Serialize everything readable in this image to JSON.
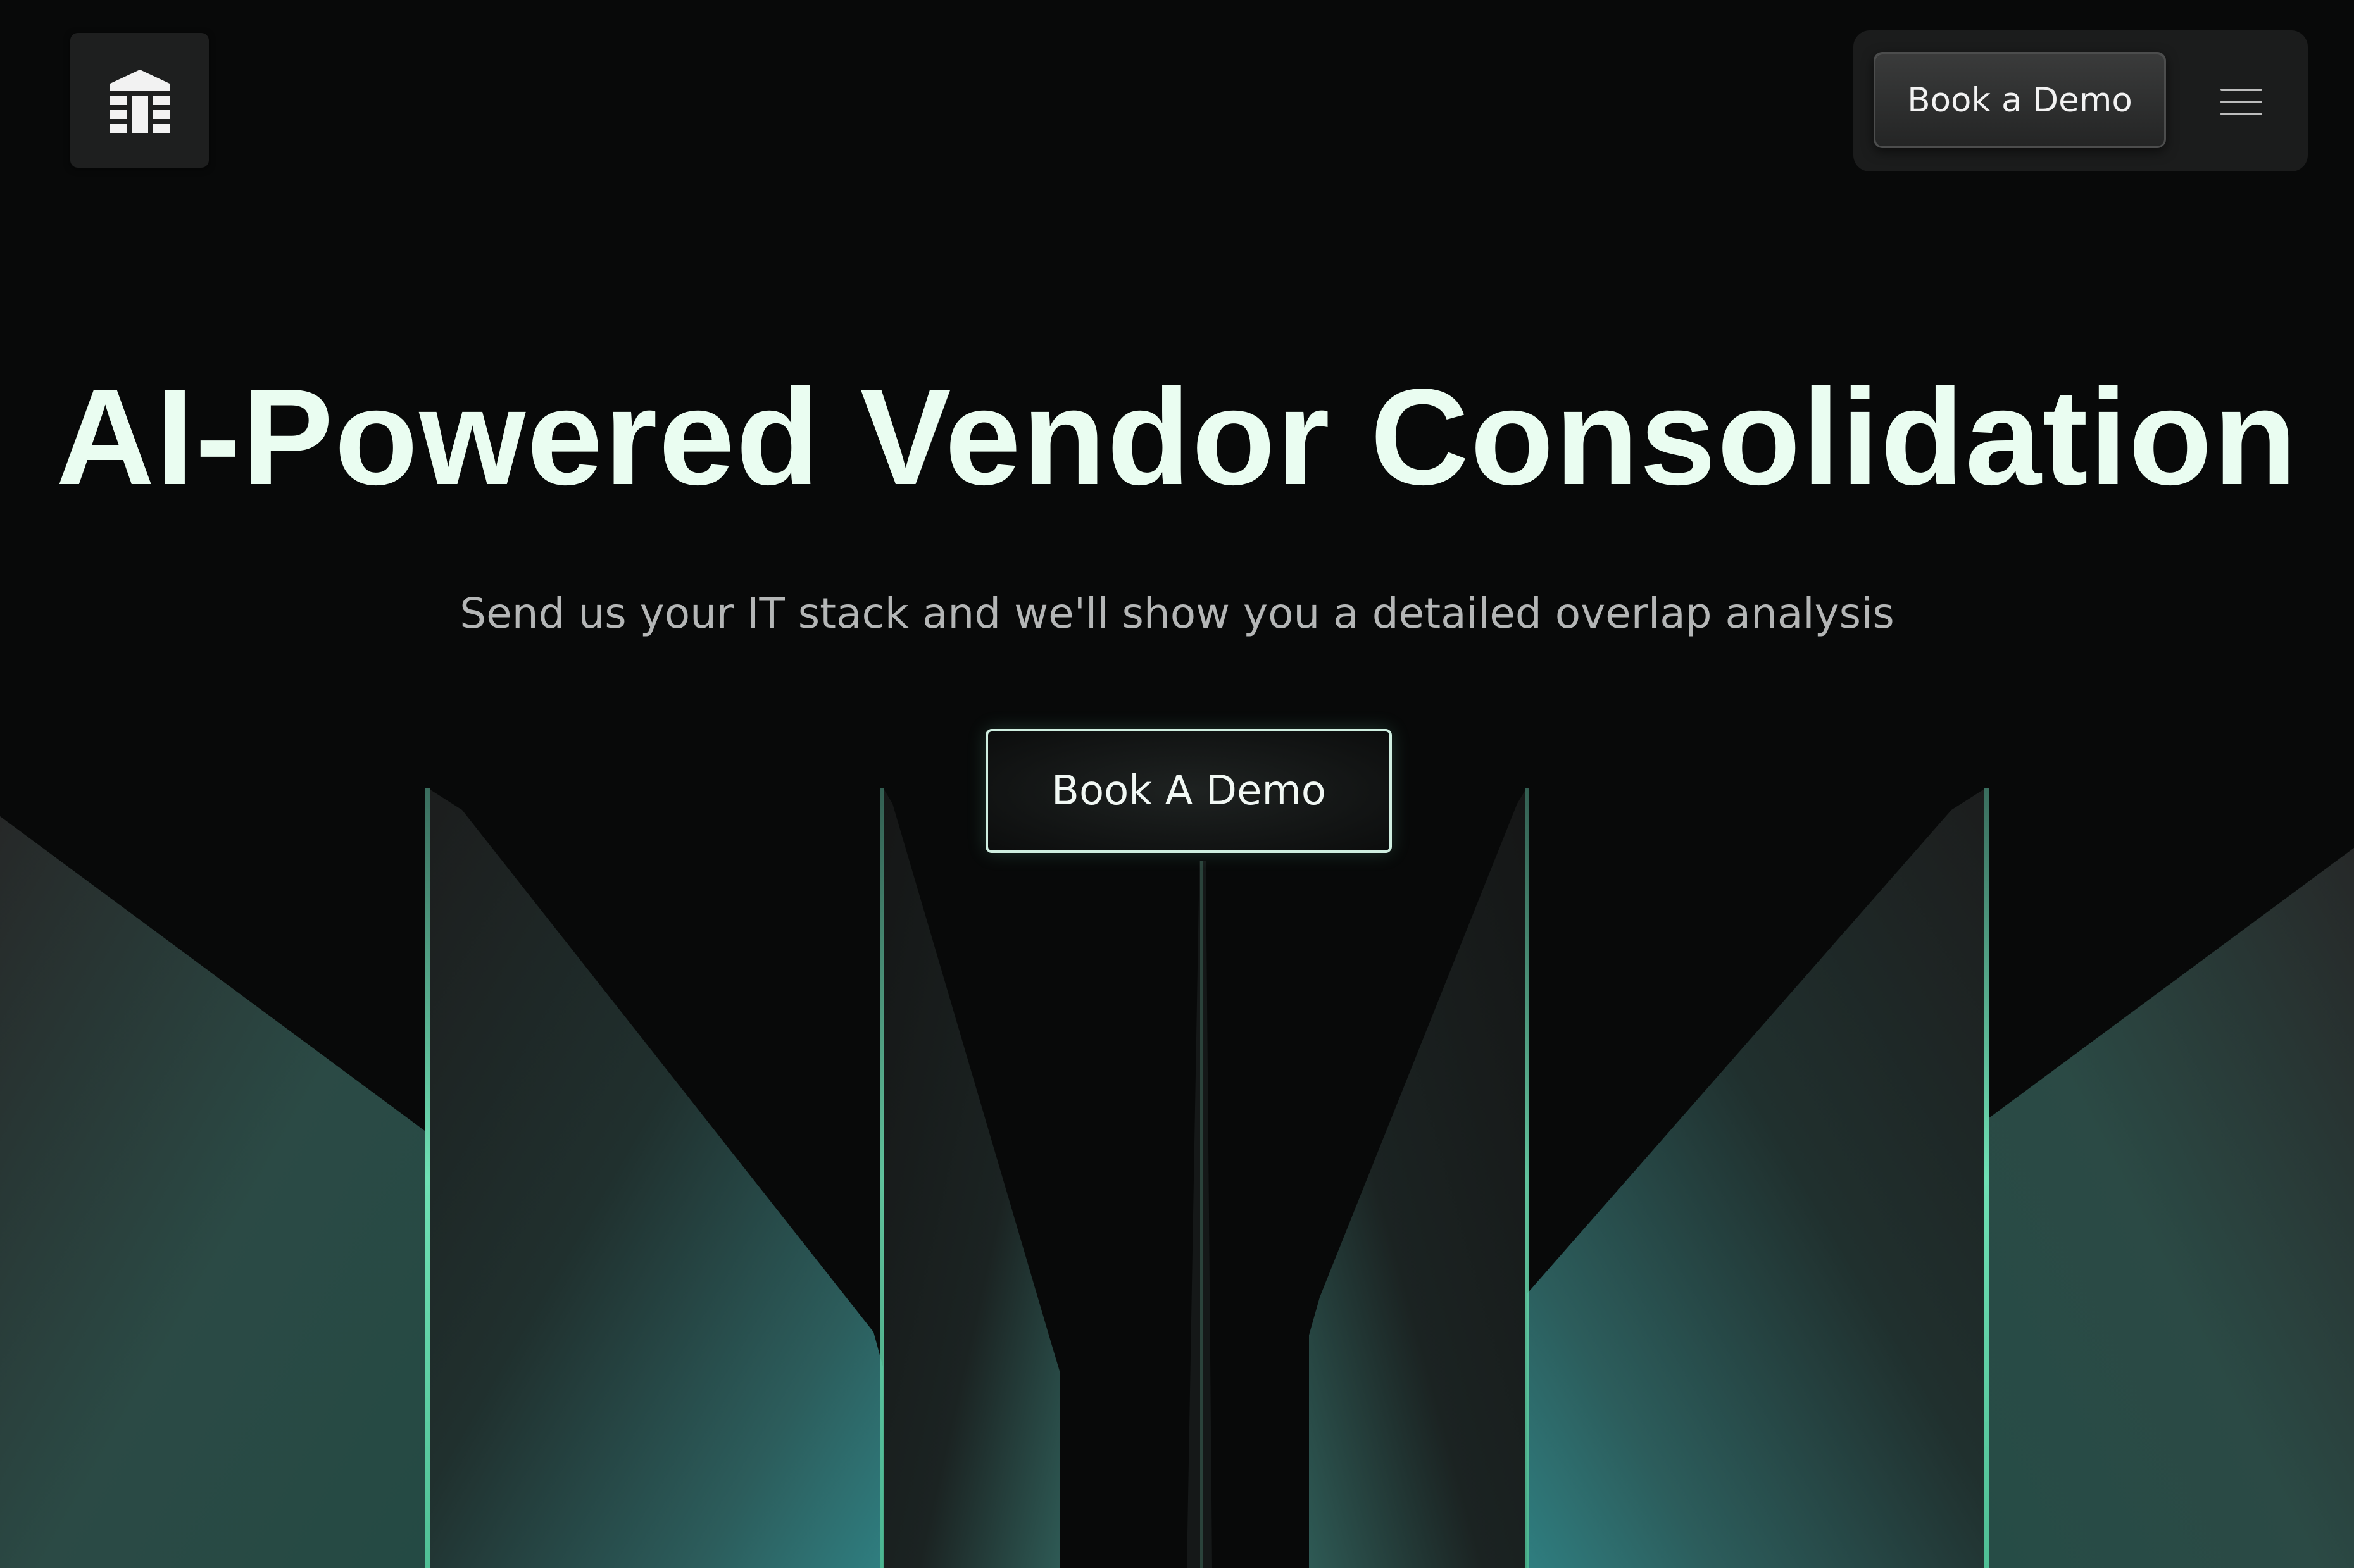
{
  "header": {
    "logo_icon": "building-logo-icon",
    "nav_demo_label": "Book a Demo",
    "menu_icon": "hamburger-menu-icon"
  },
  "hero": {
    "title": "AI-Powered Vendor Consolidation",
    "subtitle": "Send us your IT stack and we'll show you a detailed overlap analysis",
    "cta_label": "Book A Demo"
  },
  "colors": {
    "background": "#080909",
    "title": "#eafdf1",
    "subtitle": "#b4b6b6",
    "accent_edge": "#6ee0b4",
    "glass_teal": "#2f7e80"
  }
}
